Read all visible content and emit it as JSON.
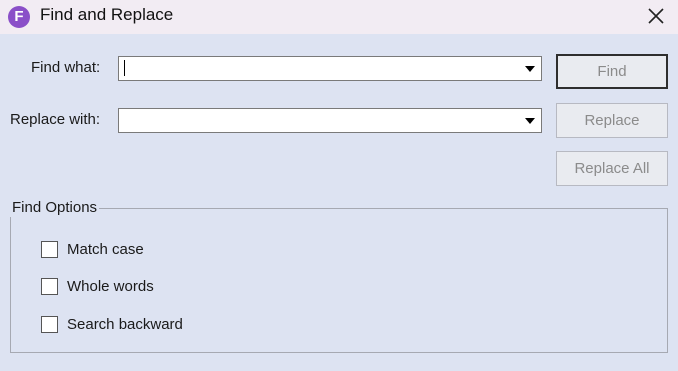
{
  "window": {
    "title": "Find and Replace",
    "close_icon": "close-icon",
    "app_icon": "app-logo-icon",
    "app_icon_letter": "F"
  },
  "form": {
    "find_label": "Find what:",
    "find_value": "",
    "replace_label": "Replace with:",
    "replace_value": ""
  },
  "buttons": {
    "find": "Find",
    "replace": "Replace",
    "replace_all": "Replace All"
  },
  "options": {
    "group_label": "Find Options",
    "items": [
      {
        "label": "Match case",
        "checked": false
      },
      {
        "label": "Whole words",
        "checked": false
      },
      {
        "label": "Search backward",
        "checked": false
      }
    ]
  },
  "colors": {
    "dialog_bg": "#dde3f2",
    "titlebar_bg": "#f2ecf3",
    "logo": "#8a4fc8",
    "disabled_text": "#8b8b8b"
  }
}
